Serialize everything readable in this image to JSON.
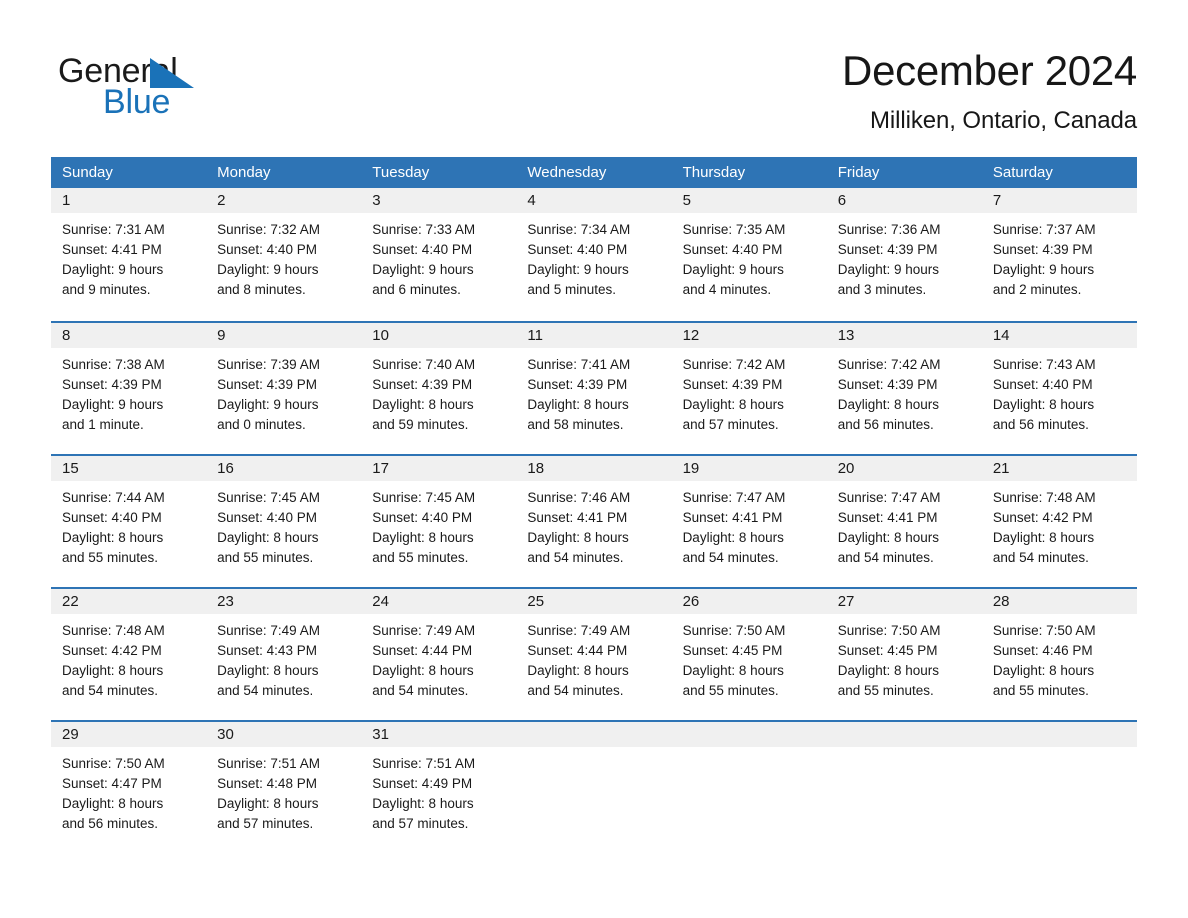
{
  "brand": {
    "name_part1": "General",
    "name_part2": "Blue",
    "accent_color": "#1a72b8"
  },
  "header": {
    "title": "December 2024",
    "location": "Milliken, Ontario, Canada"
  },
  "theme": {
    "header_blue": "#2e74b5",
    "day_band_gray": "#f0f0f0",
    "text_color": "#1a1a1a"
  },
  "calendar": {
    "weekdays": [
      "Sunday",
      "Monday",
      "Tuesday",
      "Wednesday",
      "Thursday",
      "Friday",
      "Saturday"
    ],
    "weeks": [
      [
        {
          "day": "1",
          "sunrise": "Sunrise: 7:31 AM",
          "sunset": "Sunset: 4:41 PM",
          "daylight_1": "Daylight: 9 hours",
          "daylight_2": "and 9 minutes."
        },
        {
          "day": "2",
          "sunrise": "Sunrise: 7:32 AM",
          "sunset": "Sunset: 4:40 PM",
          "daylight_1": "Daylight: 9 hours",
          "daylight_2": "and 8 minutes."
        },
        {
          "day": "3",
          "sunrise": "Sunrise: 7:33 AM",
          "sunset": "Sunset: 4:40 PM",
          "daylight_1": "Daylight: 9 hours",
          "daylight_2": "and 6 minutes."
        },
        {
          "day": "4",
          "sunrise": "Sunrise: 7:34 AM",
          "sunset": "Sunset: 4:40 PM",
          "daylight_1": "Daylight: 9 hours",
          "daylight_2": "and 5 minutes."
        },
        {
          "day": "5",
          "sunrise": "Sunrise: 7:35 AM",
          "sunset": "Sunset: 4:40 PM",
          "daylight_1": "Daylight: 9 hours",
          "daylight_2": "and 4 minutes."
        },
        {
          "day": "6",
          "sunrise": "Sunrise: 7:36 AM",
          "sunset": "Sunset: 4:39 PM",
          "daylight_1": "Daylight: 9 hours",
          "daylight_2": "and 3 minutes."
        },
        {
          "day": "7",
          "sunrise": "Sunrise: 7:37 AM",
          "sunset": "Sunset: 4:39 PM",
          "daylight_1": "Daylight: 9 hours",
          "daylight_2": "and 2 minutes."
        }
      ],
      [
        {
          "day": "8",
          "sunrise": "Sunrise: 7:38 AM",
          "sunset": "Sunset: 4:39 PM",
          "daylight_1": "Daylight: 9 hours",
          "daylight_2": "and 1 minute."
        },
        {
          "day": "9",
          "sunrise": "Sunrise: 7:39 AM",
          "sunset": "Sunset: 4:39 PM",
          "daylight_1": "Daylight: 9 hours",
          "daylight_2": "and 0 minutes."
        },
        {
          "day": "10",
          "sunrise": "Sunrise: 7:40 AM",
          "sunset": "Sunset: 4:39 PM",
          "daylight_1": "Daylight: 8 hours",
          "daylight_2": "and 59 minutes."
        },
        {
          "day": "11",
          "sunrise": "Sunrise: 7:41 AM",
          "sunset": "Sunset: 4:39 PM",
          "daylight_1": "Daylight: 8 hours",
          "daylight_2": "and 58 minutes."
        },
        {
          "day": "12",
          "sunrise": "Sunrise: 7:42 AM",
          "sunset": "Sunset: 4:39 PM",
          "daylight_1": "Daylight: 8 hours",
          "daylight_2": "and 57 minutes."
        },
        {
          "day": "13",
          "sunrise": "Sunrise: 7:42 AM",
          "sunset": "Sunset: 4:39 PM",
          "daylight_1": "Daylight: 8 hours",
          "daylight_2": "and 56 minutes."
        },
        {
          "day": "14",
          "sunrise": "Sunrise: 7:43 AM",
          "sunset": "Sunset: 4:40 PM",
          "daylight_1": "Daylight: 8 hours",
          "daylight_2": "and 56 minutes."
        }
      ],
      [
        {
          "day": "15",
          "sunrise": "Sunrise: 7:44 AM",
          "sunset": "Sunset: 4:40 PM",
          "daylight_1": "Daylight: 8 hours",
          "daylight_2": "and 55 minutes."
        },
        {
          "day": "16",
          "sunrise": "Sunrise: 7:45 AM",
          "sunset": "Sunset: 4:40 PM",
          "daylight_1": "Daylight: 8 hours",
          "daylight_2": "and 55 minutes."
        },
        {
          "day": "17",
          "sunrise": "Sunrise: 7:45 AM",
          "sunset": "Sunset: 4:40 PM",
          "daylight_1": "Daylight: 8 hours",
          "daylight_2": "and 55 minutes."
        },
        {
          "day": "18",
          "sunrise": "Sunrise: 7:46 AM",
          "sunset": "Sunset: 4:41 PM",
          "daylight_1": "Daylight: 8 hours",
          "daylight_2": "and 54 minutes."
        },
        {
          "day": "19",
          "sunrise": "Sunrise: 7:47 AM",
          "sunset": "Sunset: 4:41 PM",
          "daylight_1": "Daylight: 8 hours",
          "daylight_2": "and 54 minutes."
        },
        {
          "day": "20",
          "sunrise": "Sunrise: 7:47 AM",
          "sunset": "Sunset: 4:41 PM",
          "daylight_1": "Daylight: 8 hours",
          "daylight_2": "and 54 minutes."
        },
        {
          "day": "21",
          "sunrise": "Sunrise: 7:48 AM",
          "sunset": "Sunset: 4:42 PM",
          "daylight_1": "Daylight: 8 hours",
          "daylight_2": "and 54 minutes."
        }
      ],
      [
        {
          "day": "22",
          "sunrise": "Sunrise: 7:48 AM",
          "sunset": "Sunset: 4:42 PM",
          "daylight_1": "Daylight: 8 hours",
          "daylight_2": "and 54 minutes."
        },
        {
          "day": "23",
          "sunrise": "Sunrise: 7:49 AM",
          "sunset": "Sunset: 4:43 PM",
          "daylight_1": "Daylight: 8 hours",
          "daylight_2": "and 54 minutes."
        },
        {
          "day": "24",
          "sunrise": "Sunrise: 7:49 AM",
          "sunset": "Sunset: 4:44 PM",
          "daylight_1": "Daylight: 8 hours",
          "daylight_2": "and 54 minutes."
        },
        {
          "day": "25",
          "sunrise": "Sunrise: 7:49 AM",
          "sunset": "Sunset: 4:44 PM",
          "daylight_1": "Daylight: 8 hours",
          "daylight_2": "and 54 minutes."
        },
        {
          "day": "26",
          "sunrise": "Sunrise: 7:50 AM",
          "sunset": "Sunset: 4:45 PM",
          "daylight_1": "Daylight: 8 hours",
          "daylight_2": "and 55 minutes."
        },
        {
          "day": "27",
          "sunrise": "Sunrise: 7:50 AM",
          "sunset": "Sunset: 4:45 PM",
          "daylight_1": "Daylight: 8 hours",
          "daylight_2": "and 55 minutes."
        },
        {
          "day": "28",
          "sunrise": "Sunrise: 7:50 AM",
          "sunset": "Sunset: 4:46 PM",
          "daylight_1": "Daylight: 8 hours",
          "daylight_2": "and 55 minutes."
        }
      ],
      [
        {
          "day": "29",
          "sunrise": "Sunrise: 7:50 AM",
          "sunset": "Sunset: 4:47 PM",
          "daylight_1": "Daylight: 8 hours",
          "daylight_2": "and 56 minutes."
        },
        {
          "day": "30",
          "sunrise": "Sunrise: 7:51 AM",
          "sunset": "Sunset: 4:48 PM",
          "daylight_1": "Daylight: 8 hours",
          "daylight_2": "and 57 minutes."
        },
        {
          "day": "31",
          "sunrise": "Sunrise: 7:51 AM",
          "sunset": "Sunset: 4:49 PM",
          "daylight_1": "Daylight: 8 hours",
          "daylight_2": "and 57 minutes."
        },
        {
          "day": "",
          "sunrise": "",
          "sunset": "",
          "daylight_1": "",
          "daylight_2": ""
        },
        {
          "day": "",
          "sunrise": "",
          "sunset": "",
          "daylight_1": "",
          "daylight_2": ""
        },
        {
          "day": "",
          "sunrise": "",
          "sunset": "",
          "daylight_1": "",
          "daylight_2": ""
        },
        {
          "day": "",
          "sunrise": "",
          "sunset": "",
          "daylight_1": "",
          "daylight_2": ""
        }
      ]
    ]
  }
}
